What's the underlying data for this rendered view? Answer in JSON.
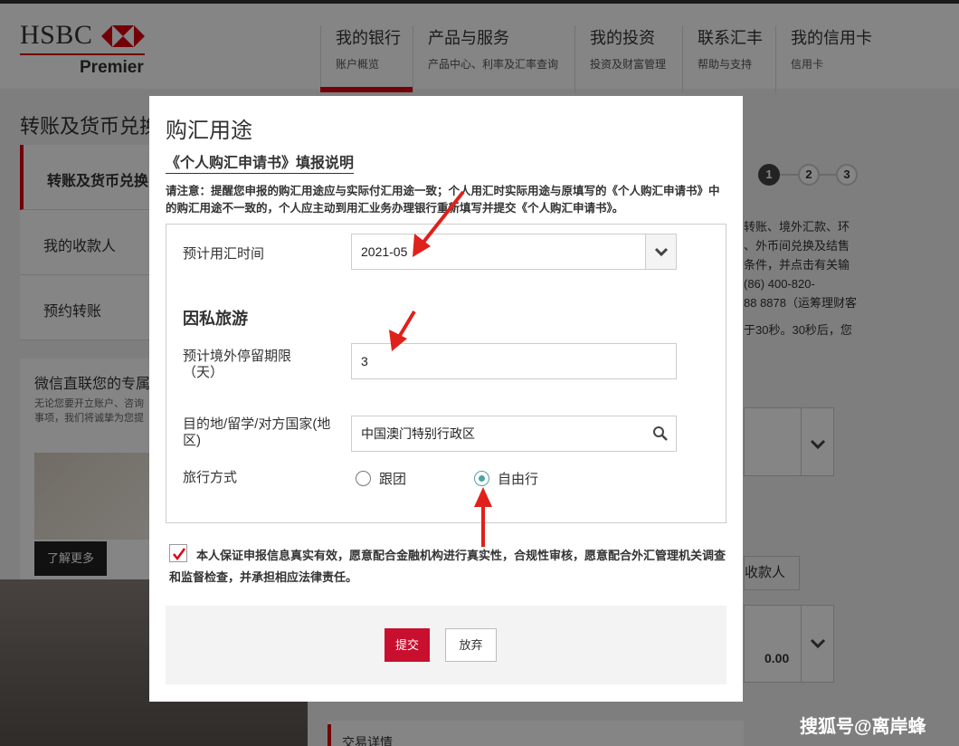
{
  "header": {
    "brand_name": "HSBC",
    "brand_tier": "Premier",
    "nav": [
      {
        "title": "我的银行",
        "sub": "账户概览"
      },
      {
        "title": "产品与服务",
        "sub": "产品中心、利率及汇率查询"
      },
      {
        "title": "我的投资",
        "sub": "投资及财富管理"
      },
      {
        "title": "联系汇丰",
        "sub": "帮助与支持"
      },
      {
        "title": "我的信用卡",
        "sub": "信用卡"
      }
    ]
  },
  "page": {
    "title": "转账及货币兑换",
    "left_menu": [
      "转账及货币兑换",
      "我的收款人",
      "预约转账"
    ],
    "promo": {
      "title": "微信直联您的专属",
      "text": "无论您要开立账户、咨询事项，我们将诚挚为您提",
      "button": "了解更多"
    },
    "steps": [
      "1",
      "2",
      "3"
    ],
    "right_text": [
      "转账、境外汇款、环",
      "、外币间兑换及结售",
      "条件，并点击有关输",
      "(86) 400-820-",
      "88 8878（运筹理财客"
    ],
    "right_note": "于30秒。30秒后，您",
    "payee_button": "收款人",
    "amount": "0.00",
    "detail_heading": "交易详情"
  },
  "modal": {
    "title": "购汇用途",
    "subtitle": "《个人购汇申请书》填报说明",
    "note": "请注意：提醒您申报的购汇用途应与实际付汇用途一致；个人用汇时实际用途与原填写的《个人购汇申请书》中的购汇用途不一致的，个人应主动到用汇业务办理银行重新填写并提交《个人购汇申请书》。",
    "fields": {
      "fx_time_label": "预计用汇时间",
      "fx_time_value": "2021-05",
      "section_heading": "因私旅游",
      "stay_label": "预计境外停留期限（天）",
      "stay_value": "3",
      "dest_label": "目的地/留学/对方国家(地区)",
      "dest_value": "中国澳门特别行政区",
      "travel_mode_label": "旅行方式",
      "travel_mode_options": [
        "跟团",
        "自由行"
      ],
      "travel_mode_selected": "自由行"
    },
    "declaration": "本人保证申报信息真实有效，愿意配合金融机构进行真实性，合规性审核，愿意配合外汇管理机关调查和监督检查，并承担相应法律责任。",
    "declaration_checked": true,
    "submit_label": "提交",
    "cancel_label": "放弃"
  },
  "watermark": "搜狐号@离岸蜂",
  "colors": {
    "brand_red": "#db0011",
    "submit_red": "#c8102e",
    "radio_teal": "#4fa3a0",
    "arrow_red": "#e0201b"
  }
}
